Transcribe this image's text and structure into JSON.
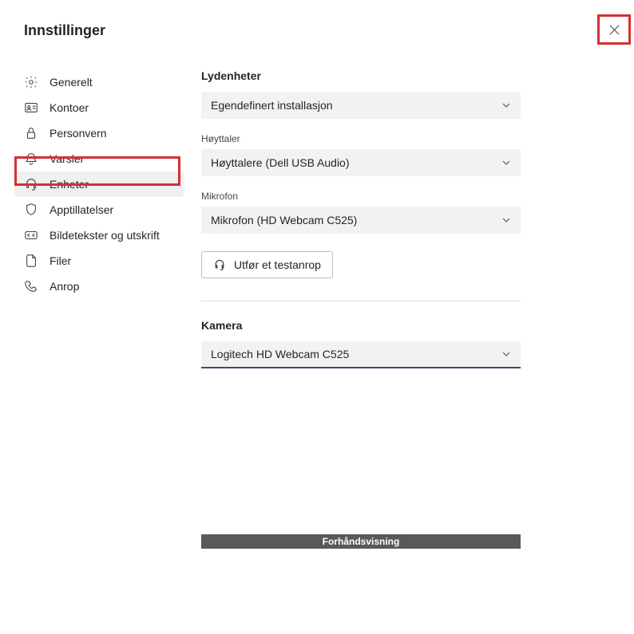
{
  "title": "Innstillinger",
  "nav": {
    "general": "Generelt",
    "accounts": "Kontoer",
    "privacy": "Personvern",
    "notifications": "Varsler",
    "devices": "Enheter",
    "app_permissions": "Apptillatelser",
    "captions": "Bildetekster og utskrift",
    "files": "Filer",
    "calls": "Anrop"
  },
  "devices": {
    "audio_devices_title": "Lydenheter",
    "audio_devices_value": "Egendefinert installasjon",
    "speaker_label": "Høyttaler",
    "speaker_value": "Høyttalere (Dell USB Audio)",
    "microphone_label": "Mikrofon",
    "microphone_value": "Mikrofon (HD Webcam C525)",
    "test_call_label": "Utfør et testanrop",
    "camera_title": "Kamera",
    "camera_value": "Logitech HD Webcam C525",
    "preview_label": "Forhåndsvisning"
  }
}
